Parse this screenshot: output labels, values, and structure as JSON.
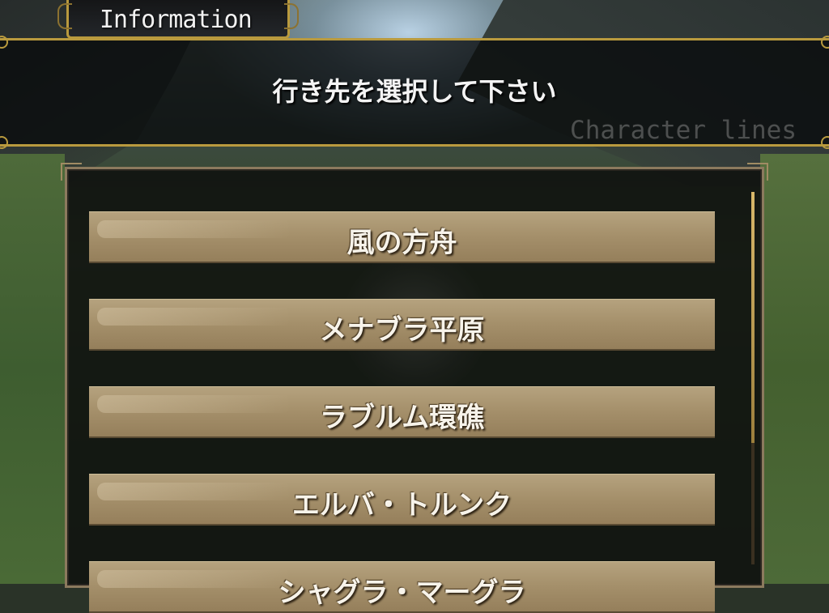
{
  "header": {
    "tab_title": "Information",
    "message": "行き先を選択して下さい",
    "watermark": "Character lines"
  },
  "destinations": [
    {
      "label": "風の方舟"
    },
    {
      "label": "メナブラ平原"
    },
    {
      "label": "ラブルム環礁"
    },
    {
      "label": "エルバ・トルンク"
    },
    {
      "label": "シャグラ・マーグラ"
    }
  ],
  "colors": {
    "frame_gold": "#b99a3e",
    "button_tan": "#a48f6a",
    "text_white": "#f4f4f4"
  }
}
